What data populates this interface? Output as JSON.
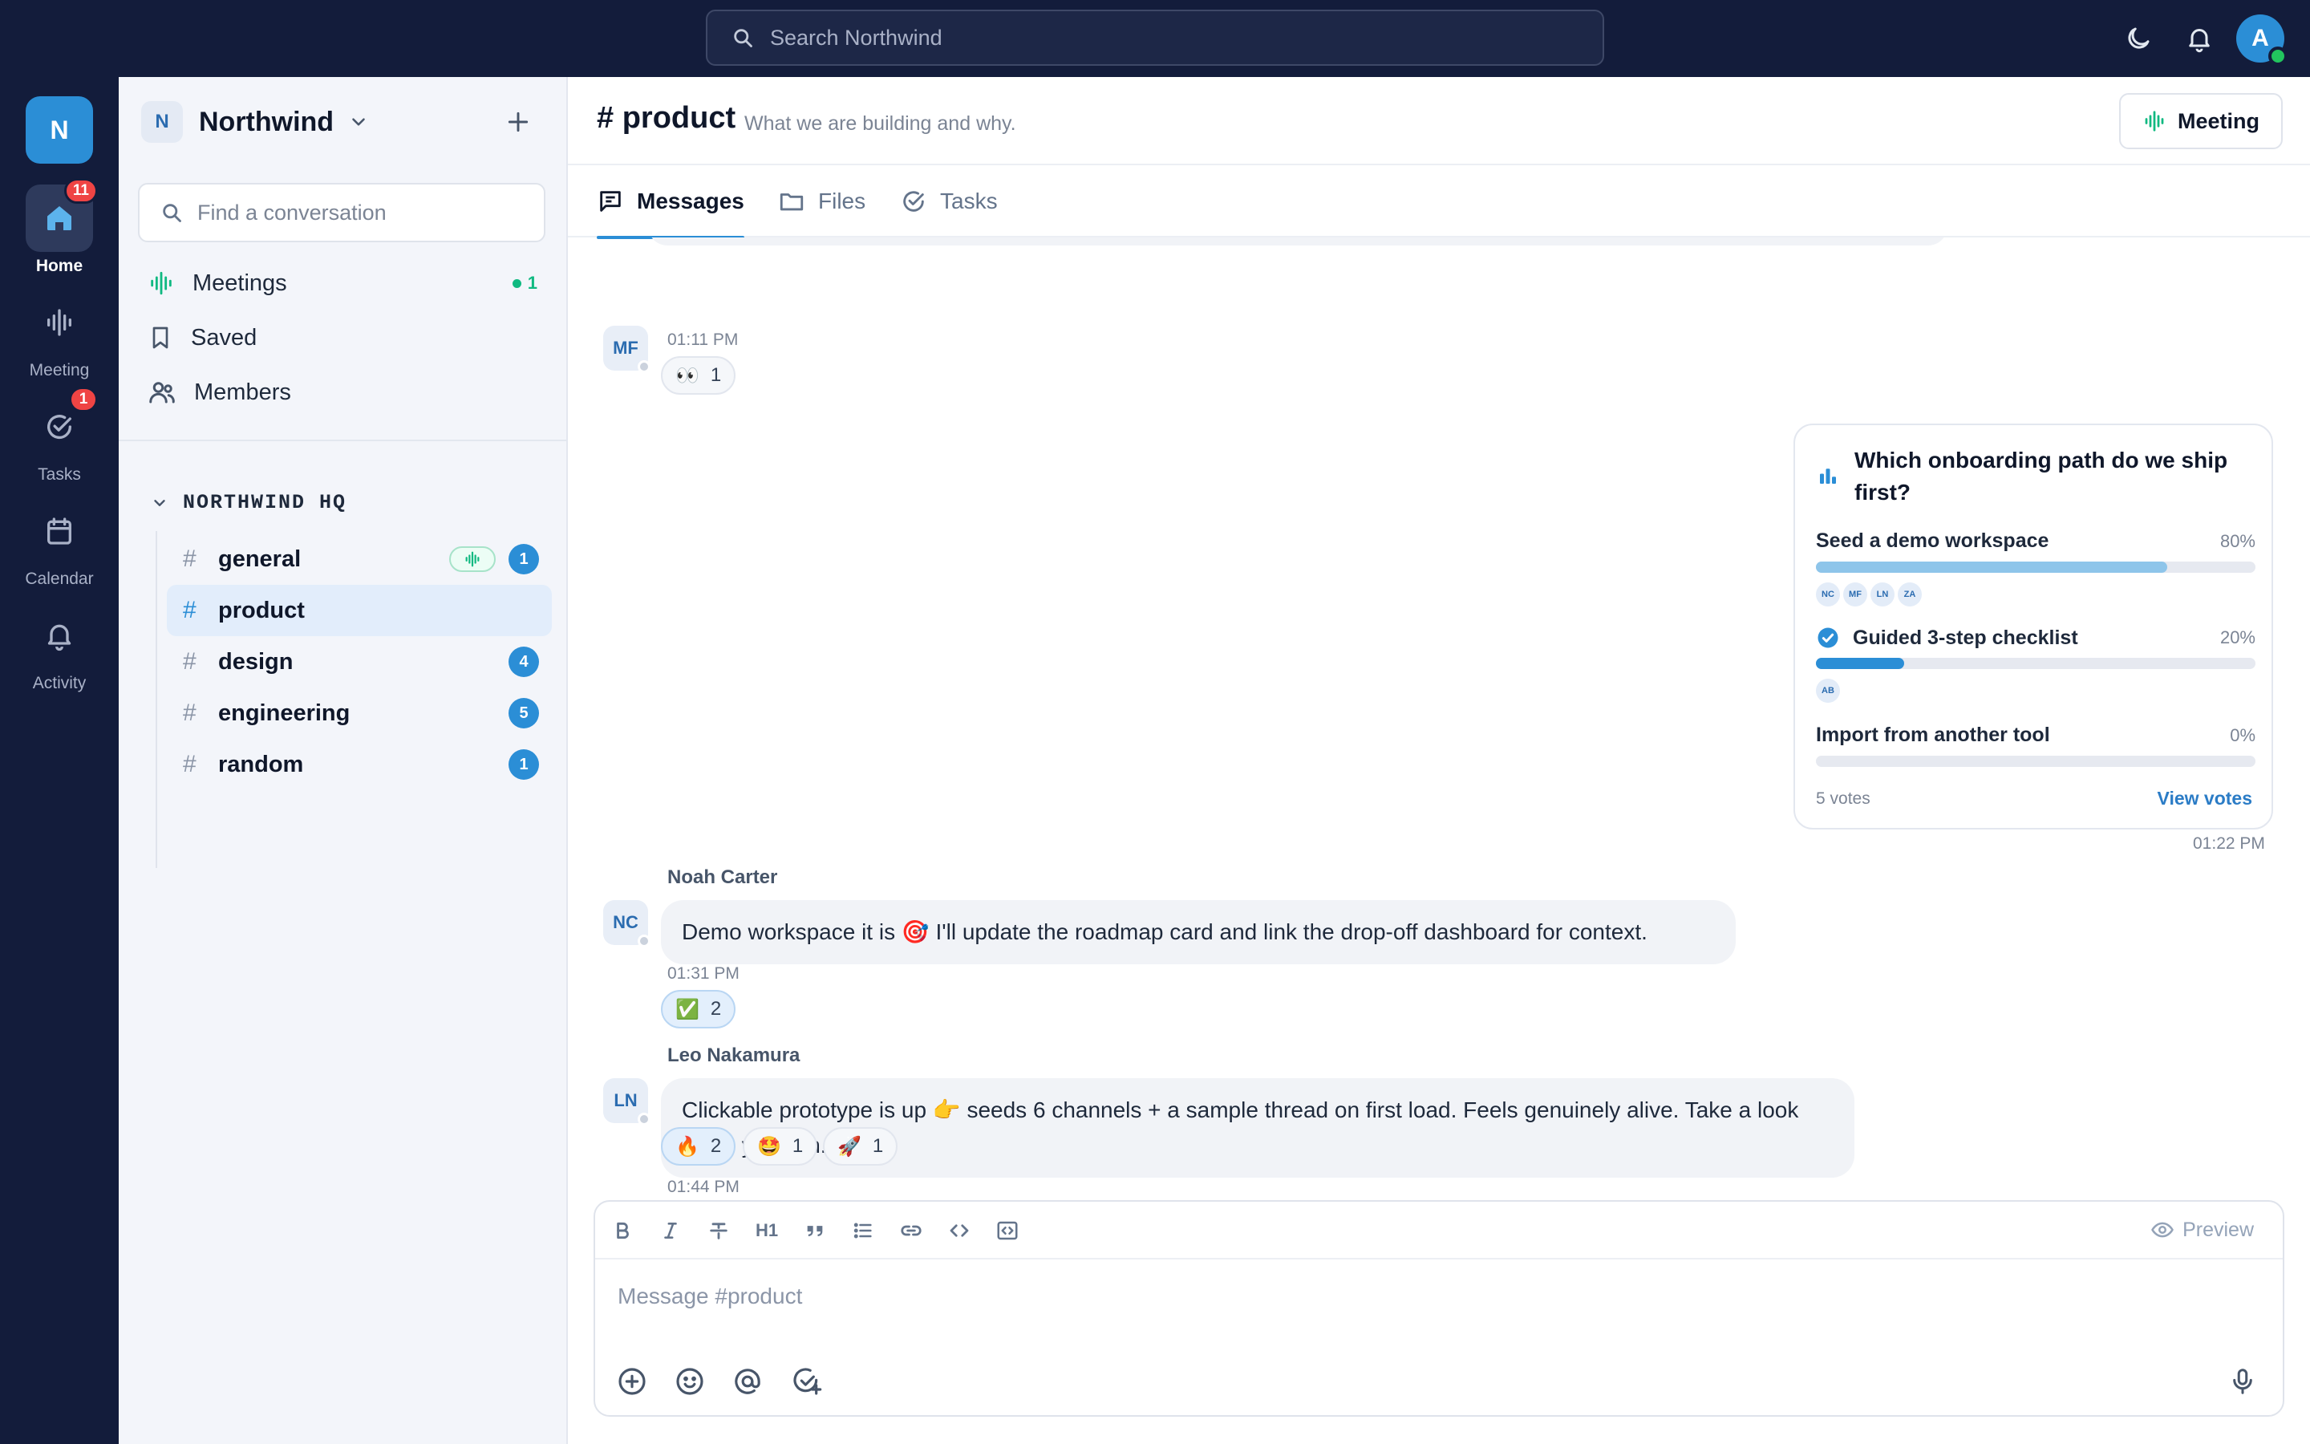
{
  "topbar": {
    "search_placeholder": "Search Northwind",
    "avatar_initial": "A"
  },
  "rail": {
    "workspace_initial": "N",
    "items": [
      {
        "label": "Home",
        "badge": "11"
      },
      {
        "label": "Meeting"
      },
      {
        "label": "Tasks",
        "badge": "1"
      },
      {
        "label": "Calendar"
      },
      {
        "label": "Activity"
      }
    ]
  },
  "sidebar": {
    "workspace_initial": "N",
    "workspace_name": "Northwind",
    "find_placeholder": "Find a conversation",
    "nav": [
      {
        "label": "Meetings",
        "count": "1"
      },
      {
        "label": "Saved"
      },
      {
        "label": "Members"
      }
    ],
    "section_title": "NORTHWIND HQ",
    "channels": [
      {
        "name": "general",
        "badge": "1"
      },
      {
        "name": "product"
      },
      {
        "name": "design",
        "badge": "4"
      },
      {
        "name": "engineering",
        "badge": "5"
      },
      {
        "name": "random",
        "badge": "1"
      }
    ]
  },
  "channel": {
    "title": "# product",
    "description": "What we are building and why.",
    "meeting_label": "Meeting",
    "tabs": [
      "Messages",
      "Files",
      "Tasks"
    ]
  },
  "messages": [
    {
      "initials": "MF",
      "time": "01:11 PM",
      "reactions": [
        {
          "emoji": "👀",
          "count": "1"
        }
      ]
    },
    {
      "sender": "Noah Carter",
      "initials": "NC",
      "text": "Demo workspace it is 🎯 I'll update the roadmap card and link the drop-off dashboard for context.",
      "time": "01:31 PM",
      "reactions": [
        {
          "emoji": "✅",
          "count": "2"
        }
      ]
    },
    {
      "sender": "Leo Nakamura",
      "initials": "LN",
      "text": "Clickable prototype is up 👉 seeds 6 channels + a sample thread on first load. Feels genuinely alive. Take a look when you can.",
      "time": "01:44 PM",
      "reactions": [
        {
          "emoji": "🔥",
          "count": "2"
        },
        {
          "emoji": "🤩",
          "count": "1"
        },
        {
          "emoji": "🚀",
          "count": "1"
        }
      ]
    }
  ],
  "poll": {
    "question": "Which onboarding path do we ship first?",
    "options": [
      {
        "label": "Seed a demo workspace",
        "percent": "80%",
        "fraction": 0.8,
        "voters": [
          "NC",
          "MF",
          "LN",
          "ZA"
        ],
        "color": "#8ec5ea"
      },
      {
        "label": "Guided 3-step checklist",
        "percent": "20%",
        "fraction": 0.2,
        "voters": [
          "AB"
        ],
        "color": "#2b8ed6",
        "selected": true
      },
      {
        "label": "Import from another tool",
        "percent": "0%",
        "fraction": 0.0,
        "voters": [],
        "color": "#2b8ed6"
      }
    ],
    "votes": "5 votes",
    "view_votes": "View votes",
    "time": "01:22 PM"
  },
  "composer": {
    "placeholder": "Message #product",
    "preview_label": "Preview",
    "heading_label": "H1"
  },
  "colors": {
    "accent": "#2b8ed6",
    "navy": "#131c3b",
    "badge_red": "#ef4444",
    "live_green": "#10b981"
  }
}
